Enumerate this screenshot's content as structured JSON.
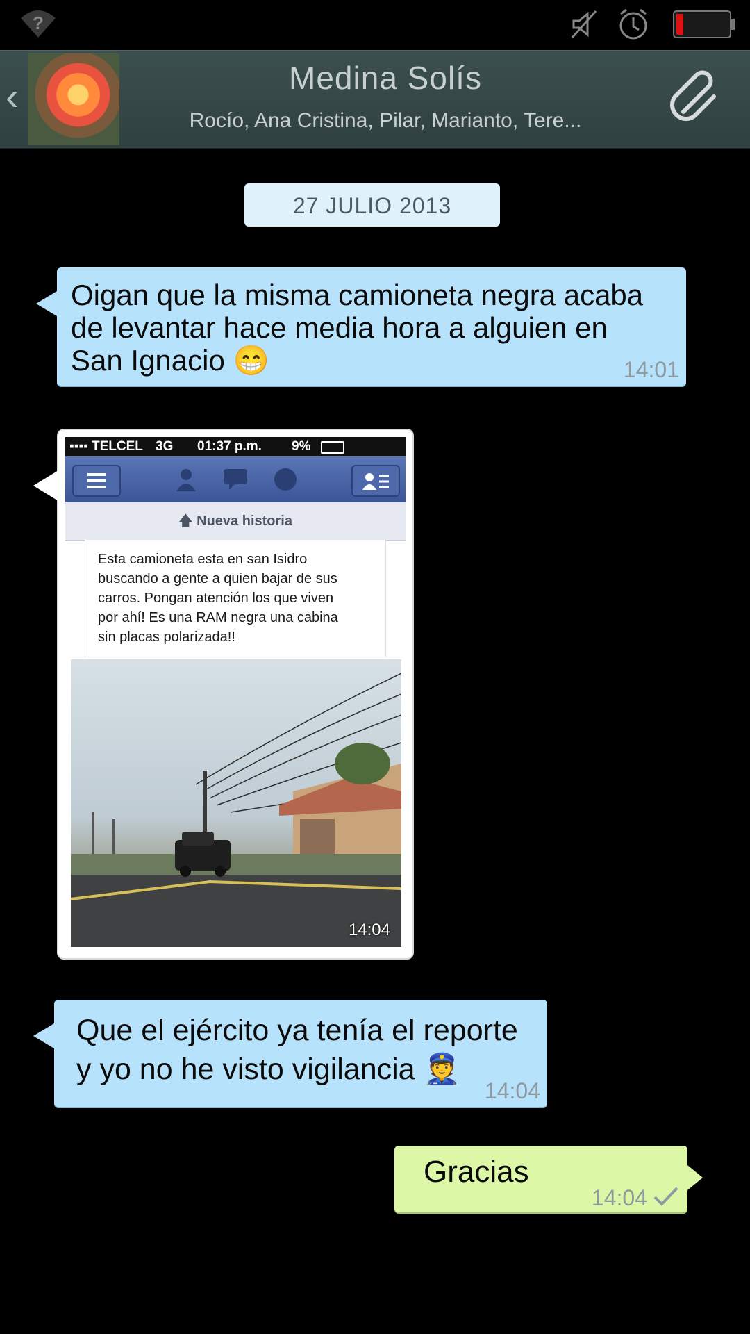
{
  "status_bar": {
    "icons": [
      "wifi-question-icon",
      "mute-icon",
      "alarm-icon",
      "battery-low-icon"
    ]
  },
  "header": {
    "back_icon": "chevron-left-icon",
    "title": "Medina Solís",
    "members": "Rocío, Ana Cristina, Pilar, Marianto, Tere...",
    "attach_icon": "paperclip-icon"
  },
  "date_badge": "27 JULIO 2013",
  "messages": [
    {
      "direction": "incoming",
      "text": "Oigan que la misma camioneta negra acaba de levantar hace media hora a alguien en San Ignacio 😁",
      "line1": "Oigan que la misma camioneta negra acaba",
      "line2": "de levantar hace media hora a alguien en",
      "line3": "San Ignacio",
      "emoji": "😁",
      "time": "14:01"
    },
    {
      "direction": "incoming",
      "type": "image",
      "time": "14:04",
      "image": {
        "carrier": "TELCEL",
        "network": "3G",
        "clock": "01:37 p.m.",
        "battery": "9%",
        "nueva_historia": "Nueva historia",
        "post_text": "Esta camioneta esta en san Isidro buscando a gente a quien bajar de sus carros. Pongan atención los que viven por ahí! Es una RAM negra una cabina sin placas polarizada!!",
        "post_line1": "Esta camioneta esta en san Isidro",
        "post_line2": "buscando a gente a quien bajar de sus",
        "post_line3": "carros. Pongan atención los que viven",
        "post_line4": "por ahí! Es una RAM negra una cabina",
        "post_line5": "sin placas polarizada!!"
      }
    },
    {
      "direction": "incoming",
      "line1": "Que el ejército ya tenía el reporte",
      "line2": "y yo no he visto vigilancia",
      "emoji": "👮",
      "time": "14:04"
    },
    {
      "direction": "outgoing",
      "text": "Gracias",
      "time": "14:04",
      "status_icon": "checkmark-icon"
    }
  ],
  "colors": {
    "header_bg": "#34474a",
    "incoming_bubble": "#b7e2fb",
    "outgoing_bubble": "#dcf8a6",
    "date_badge_bg": "#dff1fb"
  }
}
